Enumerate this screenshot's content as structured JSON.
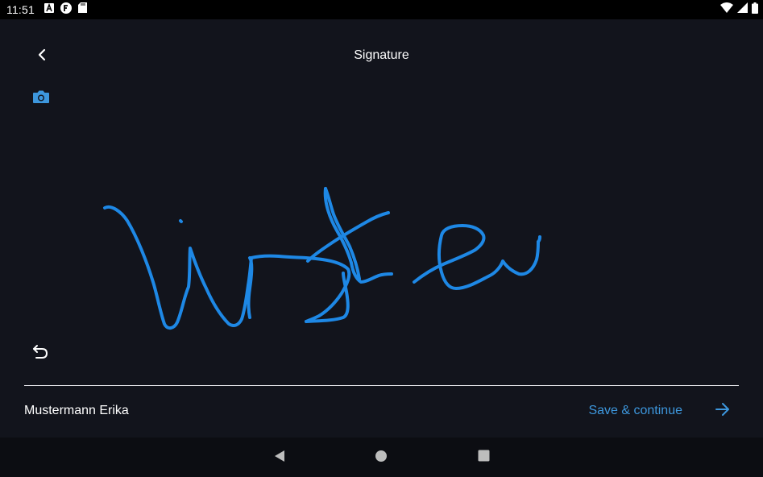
{
  "status_bar": {
    "time": "11:51",
    "left_icons": [
      "notification-a-icon",
      "notification-f-icon",
      "sd-card-icon"
    ],
    "right_icons": [
      "wifi-icon",
      "signal-icon",
      "battery-icon"
    ]
  },
  "header": {
    "title": "Signature",
    "back_icon": "chevron-left-icon"
  },
  "toolbar": {
    "camera_icon": "camera-icon",
    "undo_icon": "undo-icon"
  },
  "signature": {
    "stroke_color": "#1e88e5"
  },
  "footer": {
    "signer_name": "Mustermann Erika",
    "save_label": "Save & continue",
    "save_icon": "arrow-right-icon"
  },
  "colors": {
    "background": "#12141c",
    "accent": "#3d97dd",
    "text": "#ffffff"
  },
  "nav_bar": {
    "buttons": [
      "back-triangle-icon",
      "home-circle-icon",
      "recents-square-icon"
    ]
  }
}
